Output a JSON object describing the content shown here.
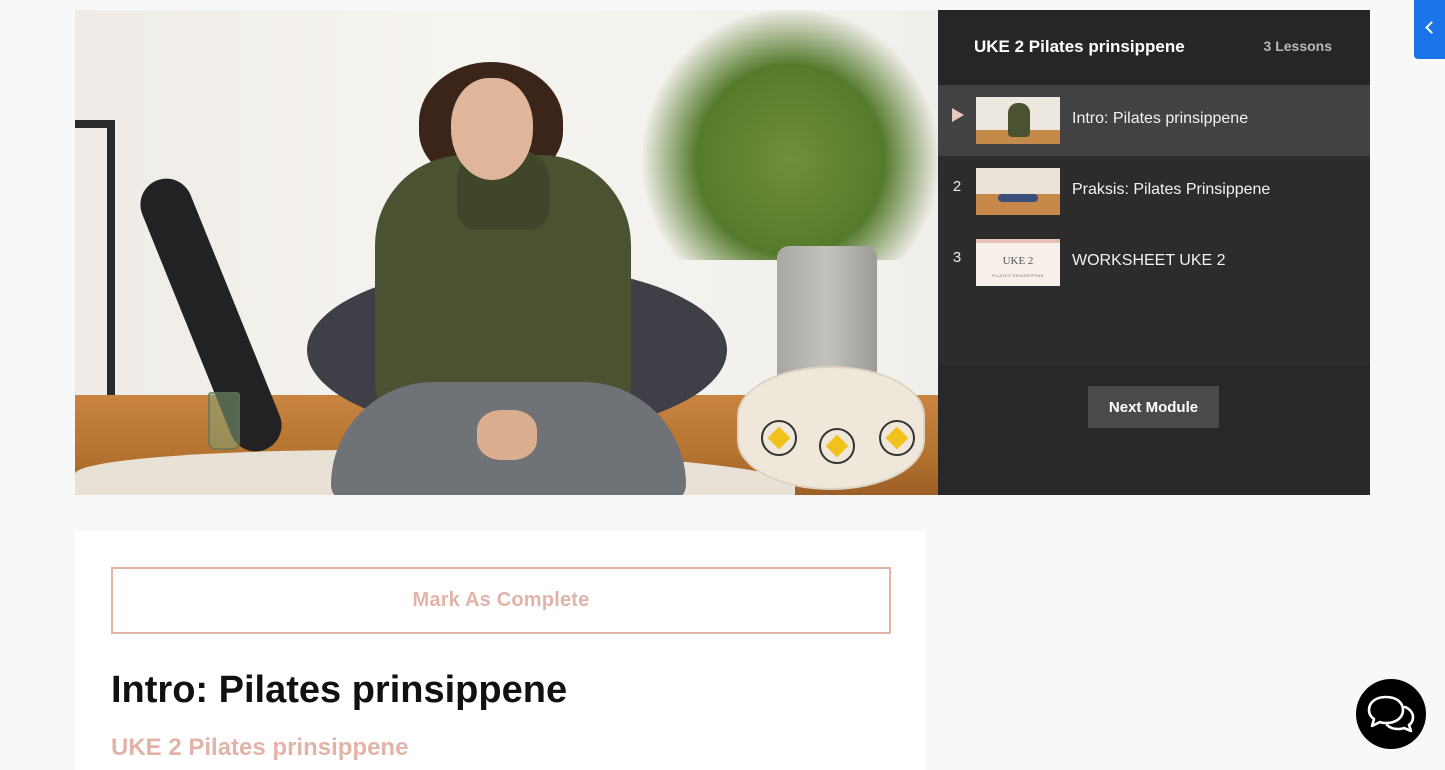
{
  "module": {
    "title": "UKE 2 Pilates prinsippene",
    "lesson_count": "3 Lessons"
  },
  "lessons": [
    {
      "index": "",
      "title": "Intro: Pilates prinsippene",
      "active": true
    },
    {
      "index": "2",
      "title": "Praksis: Pilates Prinsippene",
      "active": false
    },
    {
      "index": "3",
      "title": "WORKSHEET UKE 2",
      "active": false
    }
  ],
  "worksheet_thumb": {
    "title": "UKE 2",
    "subtitle": "PILATES PRINSIPPENE"
  },
  "next_module_label": "Next Module",
  "content": {
    "mark_complete_label": "Mark As Complete",
    "lesson_heading": "Intro: Pilates prinsippene",
    "module_subtitle": "UKE 2 Pilates prinsippene"
  },
  "icons": {
    "collapse": "chevron-left-icon",
    "chat": "chat-bubbles-icon",
    "play": "play-icon"
  },
  "colors": {
    "accent": "#e2b4a9",
    "panel_bg": "#282828",
    "active_row": "#424242",
    "tab_blue": "#1a73e8"
  }
}
